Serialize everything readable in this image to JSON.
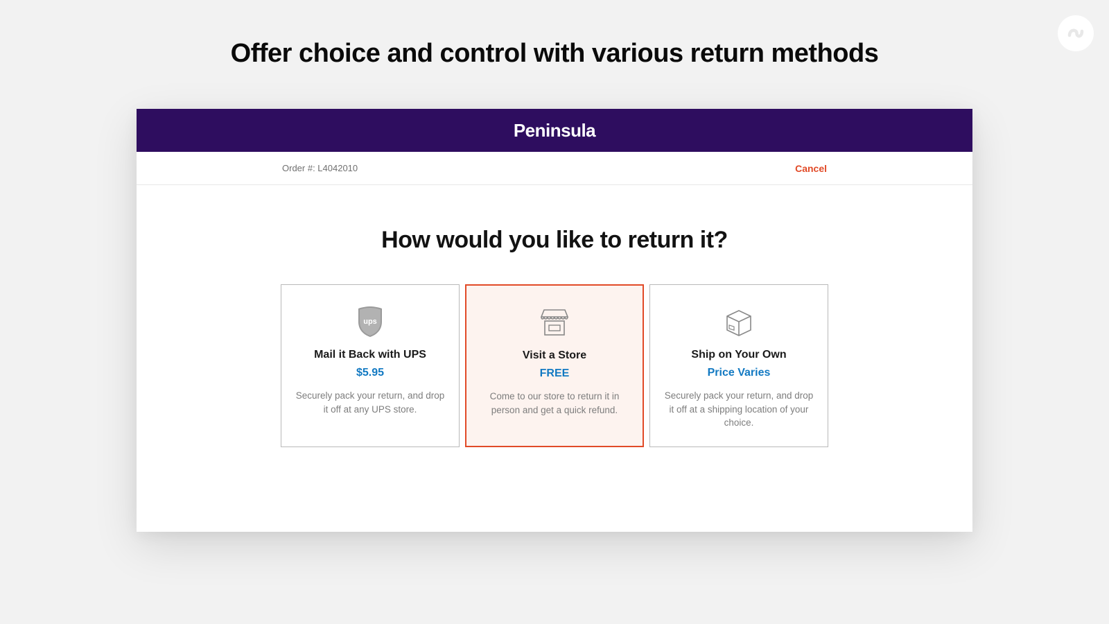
{
  "page_heading": "Offer choice and control with various return methods",
  "brand": "Peninsula",
  "order_bar": {
    "order_label": "Order #: L4042010",
    "cancel": "Cancel"
  },
  "question": "How would you like to return it?",
  "options": [
    {
      "icon": "ups-shield-icon",
      "title": "Mail it Back with UPS",
      "price": "$5.95",
      "desc": "Securely pack your return, and drop it off at any UPS store.",
      "selected": false
    },
    {
      "icon": "storefront-icon",
      "title": "Visit a Store",
      "price": "FREE",
      "desc": "Come to our store to return it in person and get a quick refund.",
      "selected": true
    },
    {
      "icon": "shipping-box-icon",
      "title": "Ship on Your Own",
      "price": "Price Varies",
      "desc": "Securely pack your return, and drop it off at a shipping location of your choice.",
      "selected": false
    }
  ]
}
